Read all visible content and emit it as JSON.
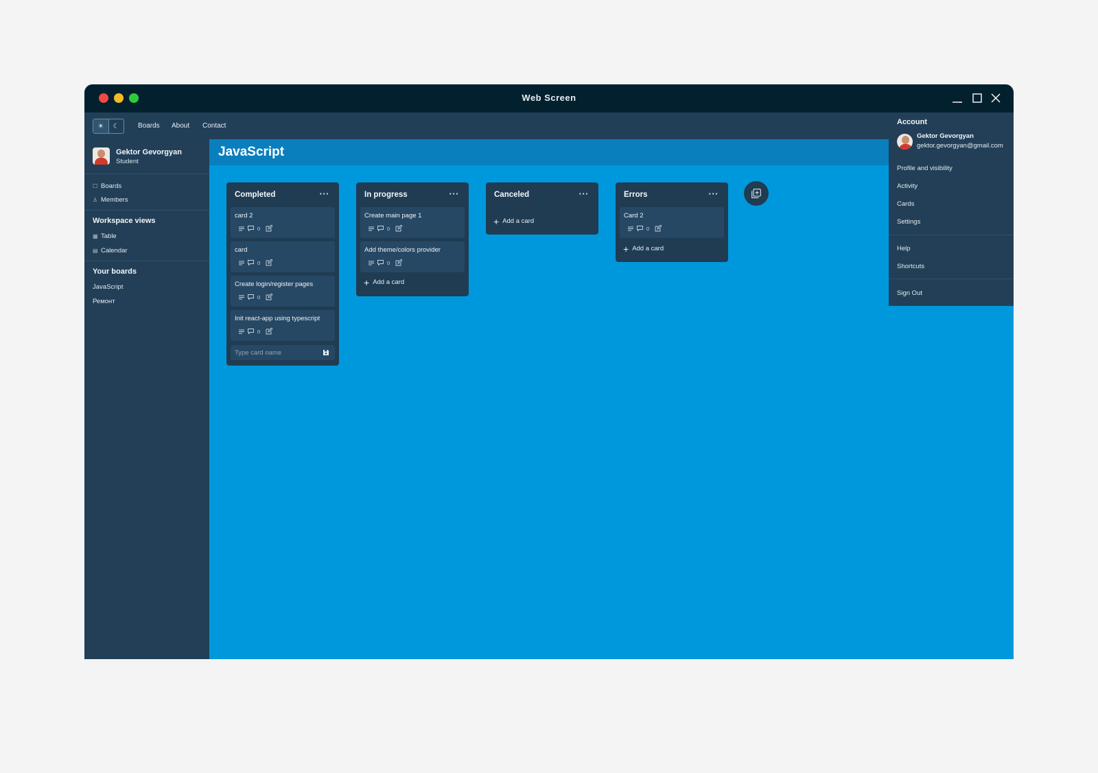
{
  "window": {
    "title": "Web Screen"
  },
  "topnav": {
    "theme_light_icon": "sun-icon",
    "theme_dark_icon": "moon-icon",
    "links": [
      "Boards",
      "About",
      "Contact"
    ]
  },
  "sidebar": {
    "user": {
      "name": "Gektor Gevorgyan",
      "role": "Student"
    },
    "items": [
      {
        "label": "Boards",
        "icon": "board-icon"
      },
      {
        "label": "Members",
        "icon": "person-icon"
      }
    ],
    "workspace_views": {
      "heading": "Workspace views",
      "items": [
        {
          "label": "Table",
          "icon": "table-icon"
        },
        {
          "label": "Calendar",
          "icon": "calendar-icon"
        }
      ]
    },
    "your_boards": {
      "heading": "Your boards",
      "items": [
        "JavaScript",
        "Ремонт"
      ]
    }
  },
  "board": {
    "title": "JavaScript",
    "lists": [
      {
        "title": "Completed",
        "cards": [
          {
            "title": "card 2",
            "comments": "0"
          },
          {
            "title": "card",
            "comments": "0"
          },
          {
            "title": "Create login/register pages",
            "comments": "0"
          },
          {
            "title": "Init react-app using typescript",
            "comments": "0"
          }
        ],
        "input_placeholder": "Type card name"
      },
      {
        "title": "In progress",
        "cards": [
          {
            "title": "Create main page 1",
            "comments": "0"
          },
          {
            "title": "Add theme/colors provider",
            "comments": "0"
          }
        ],
        "add_label": "Add a card"
      },
      {
        "title": "Canceled",
        "cards": [],
        "add_label": "Add a card"
      },
      {
        "title": "Errors",
        "cards": [
          {
            "title": "Card 2",
            "comments": "0"
          }
        ],
        "add_label": "Add a card"
      }
    ]
  },
  "account": {
    "heading": "Account",
    "name": "Gektor Gevorgyan",
    "email": "gektor.gevorgyan@gmail.com",
    "items": [
      "Profile and visibility",
      "Activity",
      "Cards",
      "Settings",
      "Help",
      "Shortcuts",
      "Sign Out"
    ]
  },
  "colors": {
    "titlebar": "#03202f",
    "panel": "#223f57",
    "board_bg": "#0098dc",
    "board_header": "#0a7fbd",
    "list_bg": "#1f3c53",
    "card_bg": "#274864"
  }
}
